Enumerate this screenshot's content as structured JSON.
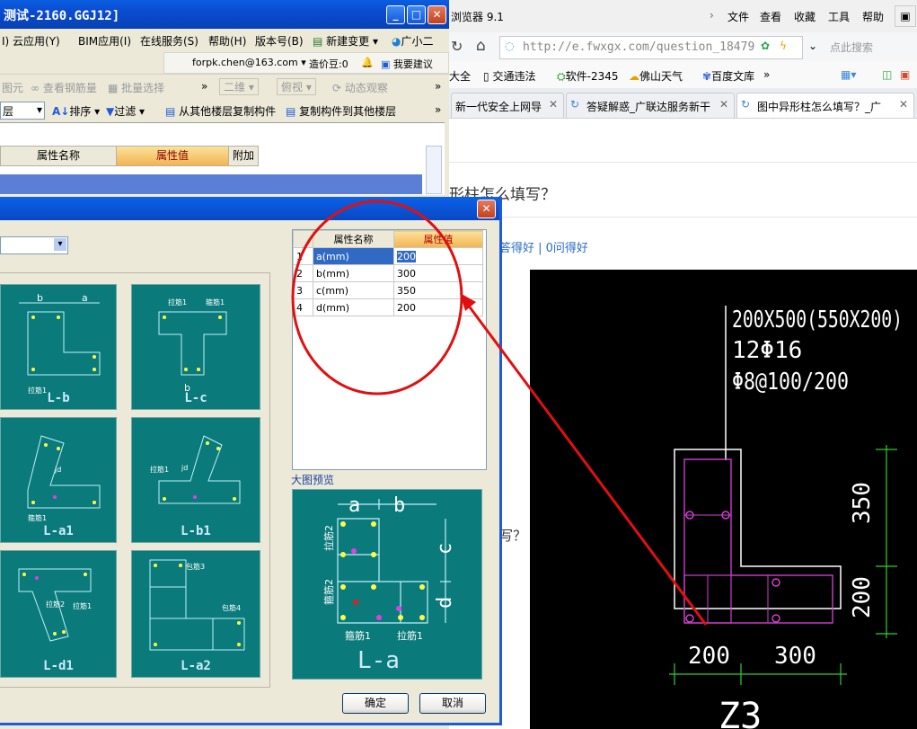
{
  "app": {
    "title": "测试-2160.GGJ12]",
    "menu": [
      "I) 云应用(Y)",
      "BIM应用(I)",
      "在线服务(S)",
      "帮助(H)",
      "版本号(B)",
      "新建变更 ▾",
      "广小二"
    ],
    "account": "forpk.chen@163.com ▾",
    "price_beans": "造价豆:0",
    "suggest": "我要建议",
    "toolbar1": [
      "图元",
      "查看钢筋量",
      "批量选择",
      "»",
      "二维 ▾",
      "俯视 ▾",
      "动态观察",
      "»"
    ],
    "toolbar2": [
      "层",
      "排序 ▾",
      "过滤 ▾",
      "从其他楼层复制构件",
      "复制构件到其他楼层",
      "»"
    ],
    "prop_headers": [
      "属性名称",
      "属性值",
      "附加"
    ]
  },
  "browser": {
    "title": "浏览器 9.1",
    "menu": [
      "文件",
      "查看",
      "收藏",
      "工具",
      "帮助"
    ],
    "url": "http://e.fwxgx.com/question_18479",
    "search_placeholder": "点此搜索",
    "favorites": [
      "大全",
      "交通违法",
      "软件-2345",
      "佛山天气",
      "百度文库",
      "»"
    ],
    "tabs": [
      "新一代安全上网导",
      "答疑解惑_广联达服务新干",
      "图中异形柱怎么填写？_广"
    ],
    "page_title_partial": "形柱怎么填写？",
    "answers_partial": "答得好 | 0问得好",
    "question_partial": "写？"
  },
  "cad": {
    "line1": "200X500(550X200)",
    "line2": "12Φ16",
    "line3": "Φ8@100/200",
    "dim_350": "350",
    "dim_200v": "200",
    "dim_200h": "200",
    "dim_300": "300",
    "bottom": "Z3"
  },
  "dialog": {
    "select_value": "",
    "thumbs": [
      "L-b",
      "L-c",
      "L-a1",
      "L-b1",
      "L-d1",
      "L-a2"
    ],
    "grid_headers": [
      "属性名称",
      "属性值"
    ],
    "rows": [
      {
        "idx": "1",
        "name": "a(mm)",
        "value": "200"
      },
      {
        "idx": "2",
        "name": "b(mm)",
        "value": "300"
      },
      {
        "idx": "3",
        "name": "c(mm)",
        "value": "350"
      },
      {
        "idx": "4",
        "name": "d(mm)",
        "value": "200"
      }
    ],
    "preview_label": "大图预览",
    "preview_caption": "L-a",
    "preview_labels": {
      "a": "a",
      "b": "b",
      "c": "c",
      "d": "d",
      "lajin2": "拉筋2",
      "gujin2": "箍筋2",
      "gujin1": "箍筋1",
      "lajin1": "拉筋1"
    },
    "thumb_labels": {
      "lajin1": "拉筋1",
      "lajin2": "拉筋2",
      "gujin1": "箍筋1",
      "gujin2": "箍筋2",
      "jd": "jd",
      "baojin3": "包筋3",
      "baojin4": "包筋4"
    },
    "ok": "确定",
    "cancel": "取消"
  }
}
